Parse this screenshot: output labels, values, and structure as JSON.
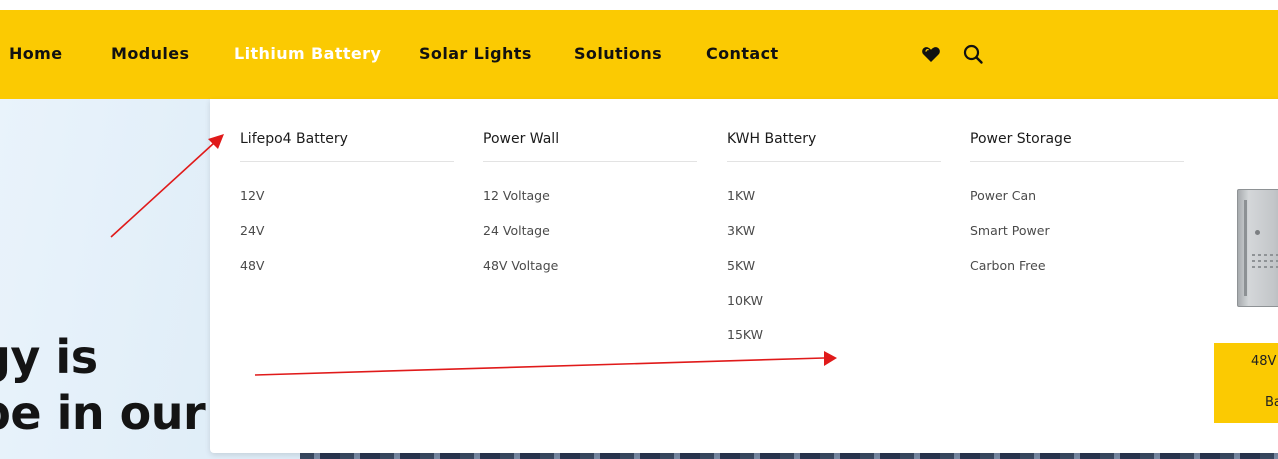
{
  "nav": {
    "items": [
      {
        "label": "Home"
      },
      {
        "label": "Modules"
      },
      {
        "label": "Lithium Battery"
      },
      {
        "label": "Solar Lights"
      },
      {
        "label": "Solutions"
      },
      {
        "label": "Contact"
      }
    ],
    "active_item": "Lithium Battery",
    "icons": [
      "heart-icon",
      "search-icon"
    ]
  },
  "hero": {
    "line1": "gy is",
    "line2": "be in our"
  },
  "mega_menu": {
    "columns": [
      {
        "title": "Lifepo4 Battery",
        "items": [
          "12V",
          "24V",
          "48V"
        ]
      },
      {
        "title": "Power Wall",
        "items": [
          "12 Voltage",
          "24 Voltage",
          "48V Voltage"
        ]
      },
      {
        "title": "KWH Battery",
        "items": [
          "1KW",
          "3KW",
          "5KW",
          "10KW",
          "15KW"
        ]
      },
      {
        "title": "Power Storage",
        "items": [
          "Power Can",
          "Smart Power",
          "Carbon Free"
        ]
      }
    ],
    "product_card": {
      "line1": "48V",
      "line2": "Ba"
    }
  },
  "colors": {
    "nav_bg": "#fbca02",
    "active_link": "#ffffff",
    "annotation_arrow": "#e01a1a"
  }
}
